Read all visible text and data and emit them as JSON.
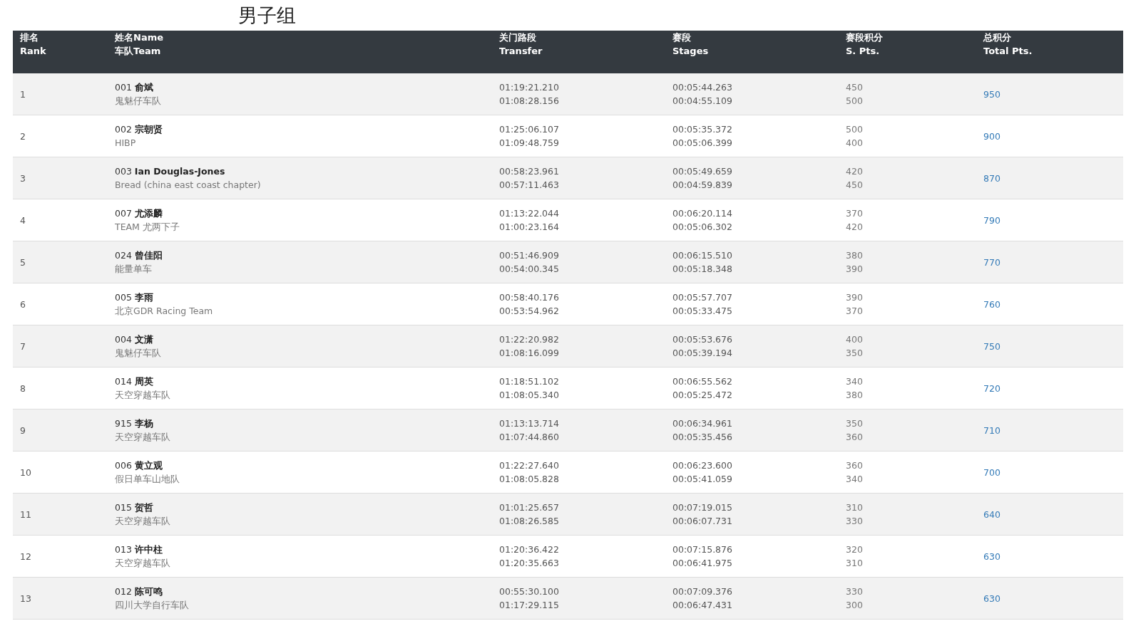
{
  "title": "男子组",
  "columns": [
    {
      "line1": "排名",
      "line2": "Rank"
    },
    {
      "line1": "姓名Name",
      "line2": "车队Team"
    },
    {
      "line1": "关门路段",
      "line2": "Transfer"
    },
    {
      "line1": "赛段",
      "line2": "Stages"
    },
    {
      "line1": "赛段积分",
      "line2": "S. Pts."
    },
    {
      "line1": "总积分",
      "line2": "Total Pts."
    }
  ],
  "rows": [
    {
      "rank": "1",
      "rider": "001 **俞斌**",
      "team": "鬼魅仔车队",
      "transfer": [
        "01:19:21.210",
        "01:08:28.156"
      ],
      "stages": [
        "00:05:44.263",
        "00:04:55.109"
      ],
      "s_pts": [
        "450",
        "500"
      ],
      "total": "950"
    },
    {
      "rank": "2",
      "rider": "002 **宗朝贤**",
      "team": "HIBP",
      "transfer": [
        "01:25:06.107",
        "01:09:48.759"
      ],
      "stages": [
        "00:05:35.372",
        "00:05:06.399"
      ],
      "s_pts": [
        "500",
        "400"
      ],
      "total": "900"
    },
    {
      "rank": "3",
      "rider": "003 **Ian Douglas-Jones**",
      "team": "Bread (china east coast chapter)",
      "transfer": [
        "00:58:23.961",
        "00:57:11.463"
      ],
      "stages": [
        "00:05:49.659",
        "00:04:59.839"
      ],
      "s_pts": [
        "420",
        "450"
      ],
      "total": "870"
    },
    {
      "rank": "4",
      "rider": "007 **尤添麟**",
      "team": "TEAM 尤两下子",
      "transfer": [
        "01:13:22.044",
        "01:00:23.164"
      ],
      "stages": [
        "00:06:20.114",
        "00:05:06.302"
      ],
      "s_pts": [
        "370",
        "420"
      ],
      "total": "790"
    },
    {
      "rank": "5",
      "rider": "024 **曾佳阳**",
      "team": "能量单车",
      "transfer": [
        "00:51:46.909",
        "00:54:00.345"
      ],
      "stages": [
        "00:06:15.510",
        "00:05:18.348"
      ],
      "s_pts": [
        "380",
        "390"
      ],
      "total": "770"
    },
    {
      "rank": "6",
      "rider": "005 **李雨**",
      "team": "北京GDR Racing Team",
      "transfer": [
        "00:58:40.176",
        "00:53:54.962"
      ],
      "stages": [
        "00:05:57.707",
        "00:05:33.475"
      ],
      "s_pts": [
        "390",
        "370"
      ],
      "total": "760"
    },
    {
      "rank": "7",
      "rider": "004 **文潇**",
      "team": "鬼魅仔车队",
      "transfer": [
        "01:22:20.982",
        "01:08:16.099"
      ],
      "stages": [
        "00:05:53.676",
        "00:05:39.194"
      ],
      "s_pts": [
        "400",
        "350"
      ],
      "total": "750"
    },
    {
      "rank": "8",
      "rider": "014 **周英**",
      "team": "天空穿越车队",
      "transfer": [
        "01:18:51.102",
        "01:08:05.340"
      ],
      "stages": [
        "00:06:55.562",
        "00:05:25.472"
      ],
      "s_pts": [
        "340",
        "380"
      ],
      "total": "720"
    },
    {
      "rank": "9",
      "rider": "915 **李杨**",
      "team": "天空穿越车队",
      "transfer": [
        "01:13:13.714",
        "01:07:44.860"
      ],
      "stages": [
        "00:06:34.961",
        "00:05:35.456"
      ],
      "s_pts": [
        "350",
        "360"
      ],
      "total": "710"
    },
    {
      "rank": "10",
      "rider": "006 **黄立观**",
      "team": "假日单车山地队",
      "transfer": [
        "01:22:27.640",
        "01:08:05.828"
      ],
      "stages": [
        "00:06:23.600",
        "00:05:41.059"
      ],
      "s_pts": [
        "360",
        "340"
      ],
      "total": "700"
    },
    {
      "rank": "11",
      "rider": "015 **贺哲**",
      "team": "天空穿越车队",
      "transfer": [
        "01:01:25.657",
        "01:08:26.585"
      ],
      "stages": [
        "00:07:19.015",
        "00:06:07.731"
      ],
      "s_pts": [
        "310",
        "330"
      ],
      "total": "640"
    },
    {
      "rank": "12",
      "rider": "013 **许中柱**",
      "team": "天空穿越车队",
      "transfer": [
        "01:20:36.422",
        "01:20:35.663"
      ],
      "stages": [
        "00:07:15.876",
        "00:06:41.975"
      ],
      "s_pts": [
        "320",
        "310"
      ],
      "total": "630"
    },
    {
      "rank": "13",
      "rider": "012 **陈可鸣**",
      "team": "四川大学自行车队",
      "transfer": [
        "00:55:30.100",
        "01:17:29.115"
      ],
      "stages": [
        "00:07:09.376",
        "00:06:47.431"
      ],
      "s_pts": [
        "330",
        "300"
      ],
      "total": "630"
    }
  ]
}
